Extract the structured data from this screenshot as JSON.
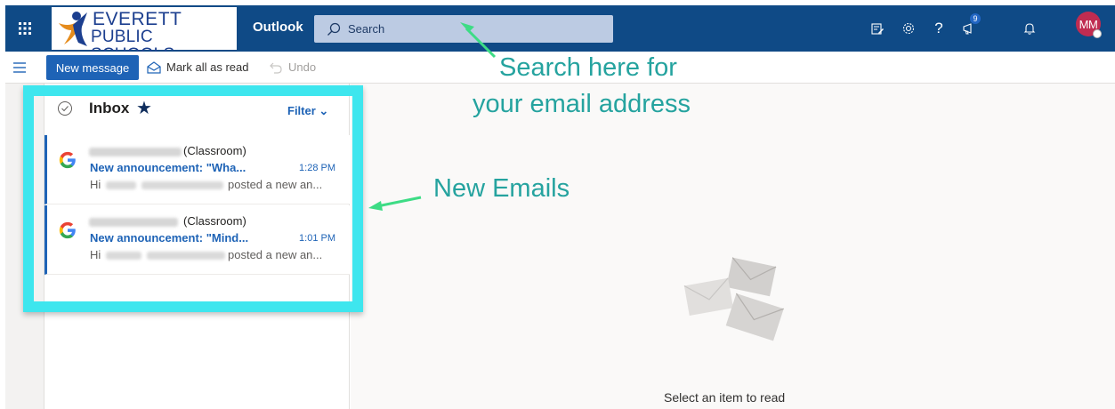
{
  "header": {
    "logo_line1": "EVERETT",
    "logo_line2": "PUBLIC SCHOOLS",
    "app_name": "Outlook",
    "search_placeholder": "Search",
    "help_label": "?",
    "notifications_count": "9",
    "avatar_initials": "MM",
    "brand_color": "#0f4a86"
  },
  "command_bar": {
    "new_message": "New message",
    "mark_all_read": "Mark all as read",
    "undo": "Undo"
  },
  "message_list": {
    "folder_title": "Inbox",
    "filter_label": "Filter",
    "messages": [
      {
        "sender_suffix": "(Classroom)",
        "subject": "New announcement: \"Wha...",
        "time": "1:28 PM",
        "preview_start": "Hi",
        "preview_end": "posted a new an..."
      },
      {
        "sender_suffix": "(Classroom)",
        "subject": "New announcement: \"Mind...",
        "time": "1:01 PM",
        "preview_start": "Hi",
        "preview_end": "posted a new an..."
      }
    ]
  },
  "reading_pane": {
    "empty_text": "Select an item to read"
  },
  "annotations": {
    "search_hint_line1": "Search here for",
    "search_hint_line2": "your email address",
    "new_emails": "New Emails",
    "annotation_color": "#25a39f",
    "highlight_color": "#3ee6ee"
  }
}
